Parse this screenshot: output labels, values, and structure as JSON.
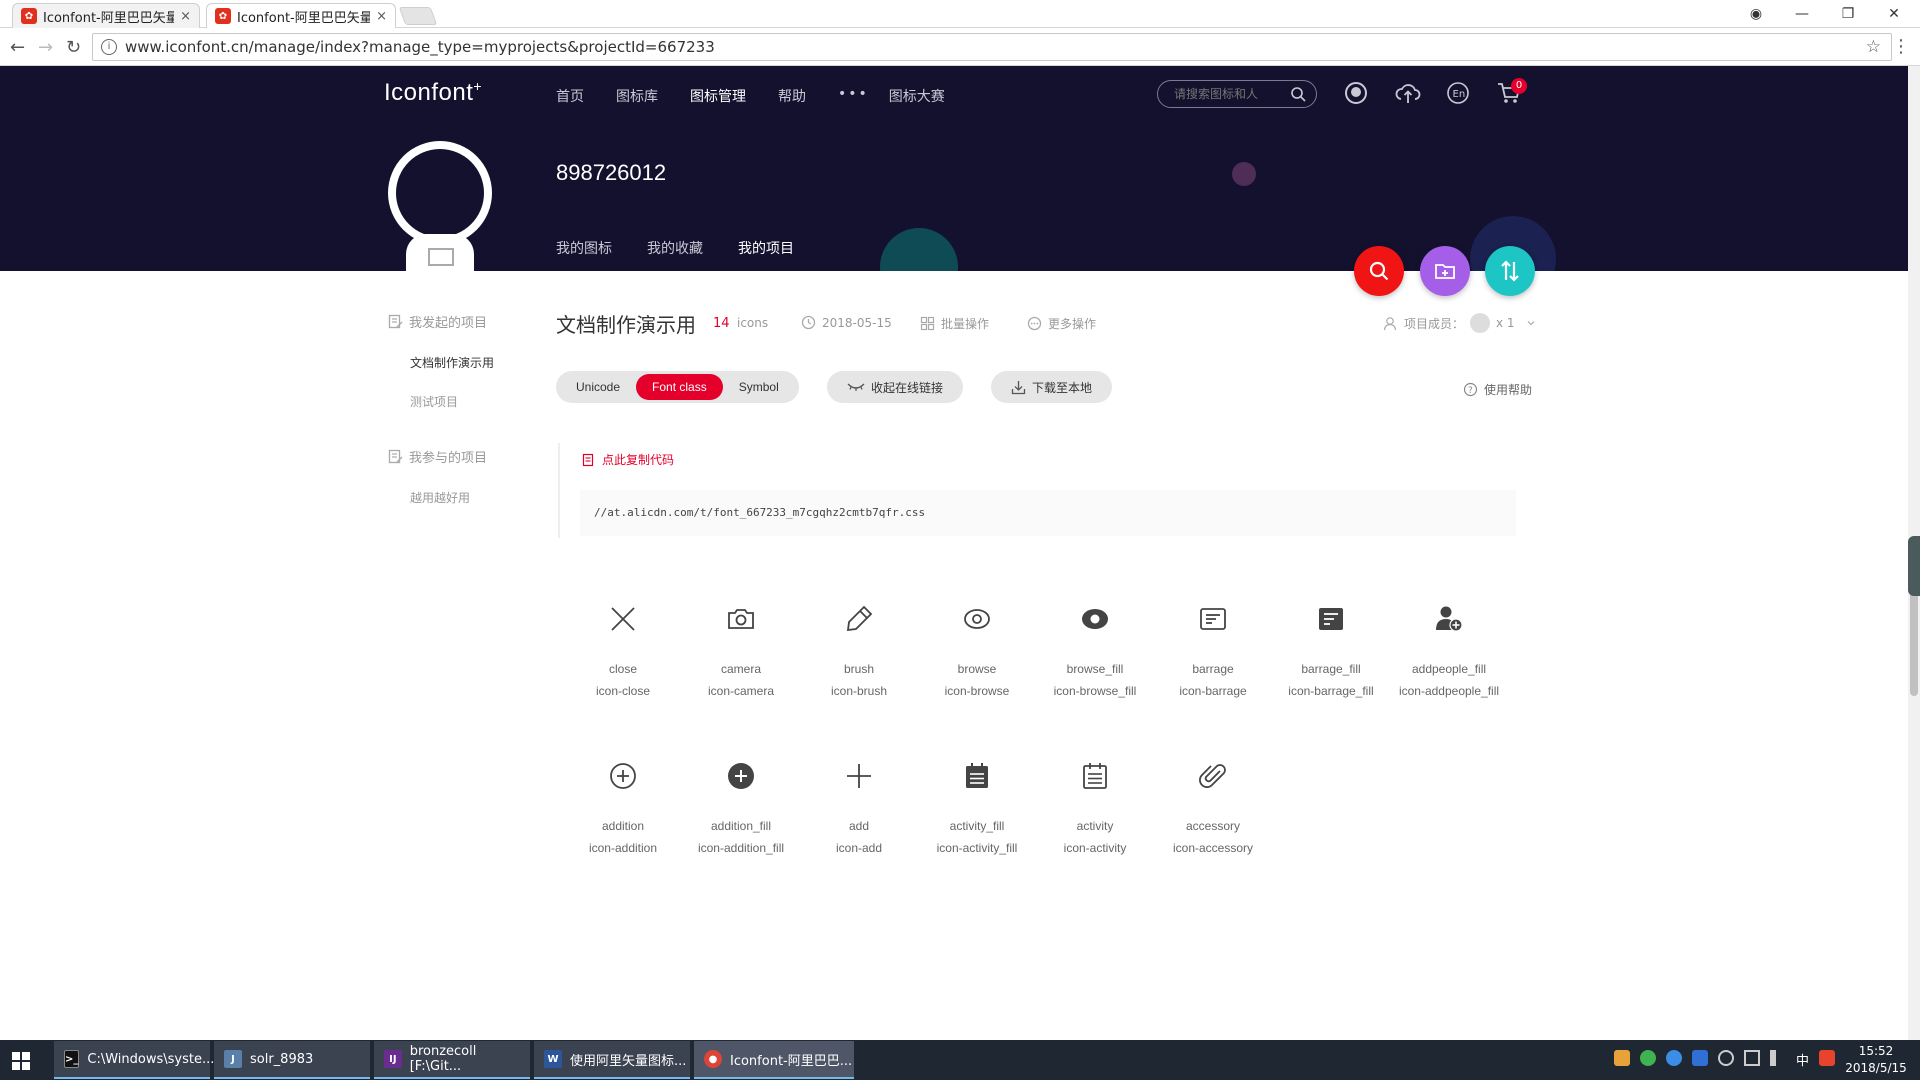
{
  "browser": {
    "tabs": [
      {
        "title": "Iconfont-阿里巴巴矢量图",
        "close": "×"
      },
      {
        "title": "Iconfont-阿里巴巴矢量图",
        "close": "×"
      }
    ],
    "url": "www.iconfont.cn/manage/index?manage_type=myprojects&projectId=667233"
  },
  "header": {
    "logo": "Iconfont",
    "nav": [
      {
        "label": "首页"
      },
      {
        "label": "图标库"
      },
      {
        "label": "图标管理"
      },
      {
        "label": "帮助"
      },
      {
        "label": "•••"
      },
      {
        "label": "图标大赛"
      }
    ],
    "search_placeholder": "请搜索图标和人",
    "cart_count": "0",
    "username": "898726012",
    "subnav": [
      {
        "label": "我的图标"
      },
      {
        "label": "我的收藏"
      },
      {
        "label": "我的项目"
      }
    ]
  },
  "sidebar": {
    "started_title": "我发起的项目",
    "started_items": [
      {
        "label": "文档制作演示用"
      },
      {
        "label": "测试项目"
      }
    ],
    "joined_title": "我参与的项目",
    "joined_items": [
      {
        "label": "越用越好用"
      }
    ]
  },
  "project": {
    "title": "文档制作演示用",
    "count": "14",
    "count_unit": "icons",
    "date": "2018-05-15",
    "batch": "批量操作",
    "more": "更多操作",
    "members_label": "项目成员：",
    "members_count": "x 1",
    "formats": [
      "Unicode",
      "Font class",
      "Symbol"
    ],
    "collapse_link": "收起在线链接",
    "download": "下载至本地",
    "help": "使用帮助",
    "copy_code": "点此复制代码",
    "css_url": "//at.alicdn.com/t/font_667233_m7cgqhz2cmtb7qfr.css"
  },
  "icons": [
    {
      "name": "close",
      "class": "icon-close",
      "glyph": "close-icon"
    },
    {
      "name": "camera",
      "class": "icon-camera",
      "glyph": "camera-icon"
    },
    {
      "name": "brush",
      "class": "icon-brush",
      "glyph": "brush-icon"
    },
    {
      "name": "browse",
      "class": "icon-browse",
      "glyph": "eye-icon"
    },
    {
      "name": "browse_fill",
      "class": "icon-browse_fill",
      "glyph": "eye-fill-icon"
    },
    {
      "name": "barrage",
      "class": "icon-barrage",
      "glyph": "barrage-icon"
    },
    {
      "name": "barrage_fill",
      "class": "icon-barrage_fill",
      "glyph": "barrage-fill-icon"
    },
    {
      "name": "addpeople_fill",
      "class": "icon-addpeople_fill",
      "glyph": "add-people-icon"
    },
    {
      "name": "addition",
      "class": "icon-addition",
      "glyph": "plus-circle-icon"
    },
    {
      "name": "addition_fill",
      "class": "icon-addition_fill",
      "glyph": "plus-circle-fill-icon"
    },
    {
      "name": "add",
      "class": "icon-add",
      "glyph": "plus-icon"
    },
    {
      "name": "activity_fill",
      "class": "icon-activity_fill",
      "glyph": "calendar-fill-icon"
    },
    {
      "name": "activity",
      "class": "icon-activity",
      "glyph": "calendar-icon"
    },
    {
      "name": "accessory",
      "class": "icon-accessory",
      "glyph": "paperclip-icon"
    }
  ],
  "taskbar": {
    "tasks": [
      {
        "label": "C:\\Windows\\syste..."
      },
      {
        "label": "solr_8983"
      },
      {
        "label": "bronzecoll [F:\\Git..."
      },
      {
        "label": "使用阿里矢量图标..."
      },
      {
        "label": "Iconfont-阿里巴巴..."
      }
    ],
    "time": "15:52",
    "date": "2018/5/15",
    "ime": "中"
  },
  "colors": {
    "header_bg": "#13112d",
    "accent": "#e4002b",
    "fab_search": "#f01414",
    "fab_add": "#a45ee8",
    "fab_sort": "#1ec5c5"
  }
}
